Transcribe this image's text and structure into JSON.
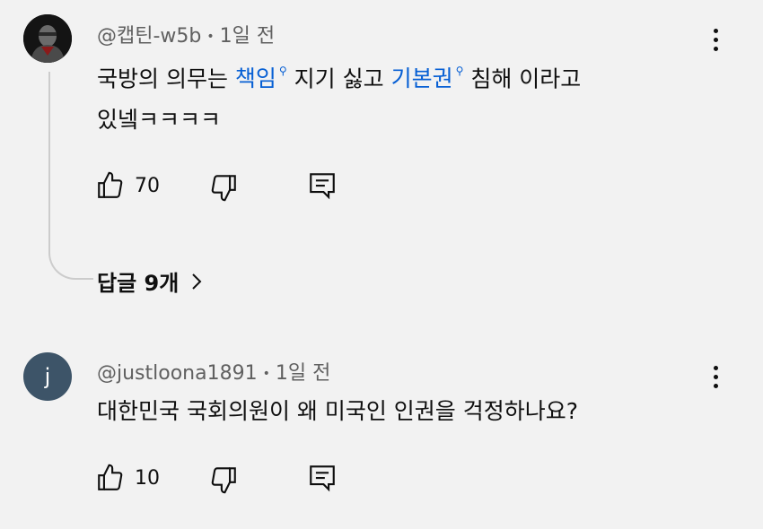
{
  "comments": [
    {
      "author": "@캡틴-w5b",
      "time": "1일 전",
      "text": {
        "part1": "국방의 의무는 ",
        "link1": "책임",
        "part2": " 지기 싫고 ",
        "link2": "기본권",
        "part3": " 침해 이라고",
        "line2": "있넼ㅋㅋㅋㅋ"
      },
      "likes": "70",
      "replies_label": "답글 9개"
    },
    {
      "author": "@justloona1891",
      "avatar_letter": "j",
      "time": "1일 전",
      "text": {
        "line1": "대한민국 국회의원이 왜 미국인 인권을 걱정하나요?"
      },
      "likes": "10"
    }
  ],
  "colors": {
    "link": "#065fd4",
    "meta": "#606060",
    "avatar_j": "#3d5468",
    "background": "#f2f2f2"
  },
  "icons": {
    "like": "thumb-up-icon",
    "dislike": "thumb-down-icon",
    "reply": "comment-icon",
    "more": "more-vertical-icon",
    "search": "search-icon",
    "chevron": "chevron-right-icon"
  }
}
